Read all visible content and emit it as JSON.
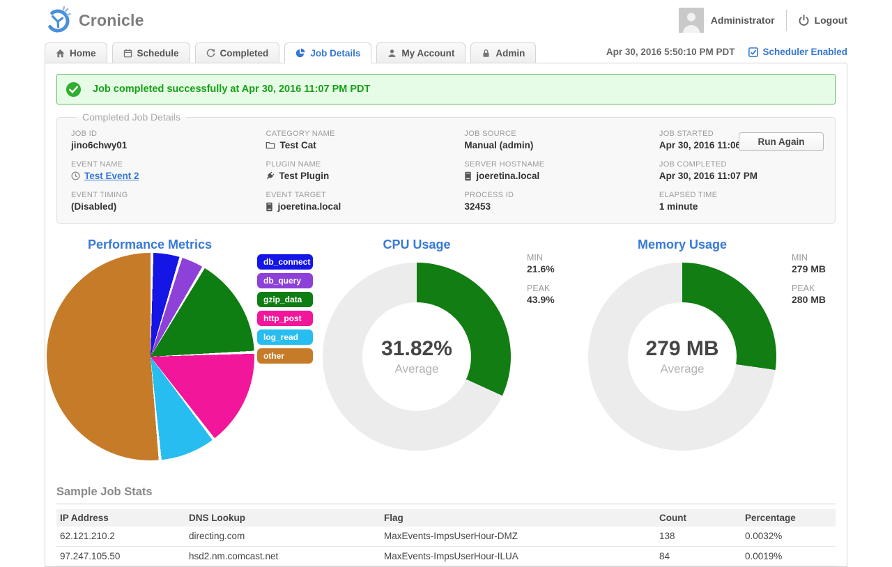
{
  "header": {
    "brand": "Cronicle",
    "user": "Administrator",
    "logout": "Logout"
  },
  "tabbar": {
    "tabs": [
      {
        "label": "Home",
        "icon": "home-icon",
        "active": false
      },
      {
        "label": "Schedule",
        "icon": "calendar-icon",
        "active": false
      },
      {
        "label": "Completed",
        "icon": "history-icon",
        "active": false
      },
      {
        "label": "Job Details",
        "icon": "pie-chart-icon",
        "active": true
      },
      {
        "label": "My Account",
        "icon": "user-icon",
        "active": false
      },
      {
        "label": "Admin",
        "icon": "lock-icon",
        "active": false
      }
    ],
    "clock": "Apr 30, 2016 5:50:10 PM PDT",
    "scheduler_label": "Scheduler Enabled"
  },
  "banner": {
    "message": "Job completed successfully at Apr 30, 2016 11:07 PM PDT"
  },
  "job_details": {
    "legend": "Completed Job Details",
    "run_again_label": "Run Again",
    "fields": [
      {
        "label": "JOB ID",
        "value": "jino6chwy01"
      },
      {
        "label": "EVENT NAME",
        "value": "Test Event 2",
        "icon": "clock-icon",
        "link": true
      },
      {
        "label": "EVENT TIMING",
        "value": "(Disabled)"
      },
      {
        "label": "CATEGORY NAME",
        "value": "Test Cat",
        "icon": "folder-icon"
      },
      {
        "label": "PLUGIN NAME",
        "value": "Test Plugin",
        "icon": "plug-icon"
      },
      {
        "label": "EVENT TARGET",
        "value": "joeretina.local",
        "icon": "server-icon"
      },
      {
        "label": "JOB SOURCE",
        "value": "Manual (admin)"
      },
      {
        "label": "SERVER HOSTNAME",
        "value": "joeretina.local",
        "icon": "server-icon"
      },
      {
        "label": "PROCESS ID",
        "value": "32453"
      },
      {
        "label": "JOB STARTED",
        "value": "Apr 30, 2016 11:06 PM"
      },
      {
        "label": "JOB COMPLETED",
        "value": "Apr 30, 2016 11:07 PM"
      },
      {
        "label": "ELAPSED TIME",
        "value": "1 minute"
      }
    ]
  },
  "chart_data": [
    {
      "type": "pie",
      "title": "Performance Metrics",
      "legend_position": "right",
      "slices": [
        {
          "label": "db_connect",
          "value": 4.5,
          "color": "#1515e6"
        },
        {
          "label": "db_query",
          "value": 3.8,
          "color": "#8d41d9"
        },
        {
          "label": "gzip_data",
          "value": 15.8,
          "color": "#0e7d12"
        },
        {
          "label": "http_post",
          "value": 15.3,
          "color": "#f2169b"
        },
        {
          "label": "log_read",
          "value": 8.9,
          "color": "#27bdf0"
        },
        {
          "label": "other",
          "value": 51.7,
          "color": "#c67b28"
        }
      ]
    },
    {
      "type": "donut",
      "title": "CPU Usage",
      "center_value": "31.82%",
      "center_label": "Average",
      "min_label": "MIN",
      "min_value": "21.6%",
      "peak_label": "PEAK",
      "peak_value": "43.9%",
      "fill_fraction": 0.3182,
      "fill_color": "#127d12",
      "track_color": "#ececec"
    },
    {
      "type": "donut",
      "title": "Memory Usage",
      "center_value": "279 MB",
      "center_label": "Average",
      "min_label": "MIN",
      "min_value": "279 MB",
      "peak_label": "PEAK",
      "peak_value": "280 MB",
      "fill_fraction": 0.2725,
      "fill_color": "#127d12",
      "track_color": "#ececec"
    }
  ],
  "stats": {
    "heading": "Sample Job Stats",
    "columns": [
      "IP Address",
      "DNS Lookup",
      "Flag",
      "Count",
      "Percentage"
    ],
    "rows": [
      [
        "62.121.210.2",
        "directing.com",
        "MaxEvents-ImpsUserHour-DMZ",
        "138",
        "0.0032%"
      ],
      [
        "97.247.105.50",
        "hsd2.nm.comcast.net",
        "MaxEvents-ImpsUserHour-ILUA",
        "84",
        "0.0019%"
      ]
    ]
  },
  "colors": {
    "accent_blue": "#3577d4",
    "banner_green": "#16a016",
    "donut_green": "#127d12"
  }
}
